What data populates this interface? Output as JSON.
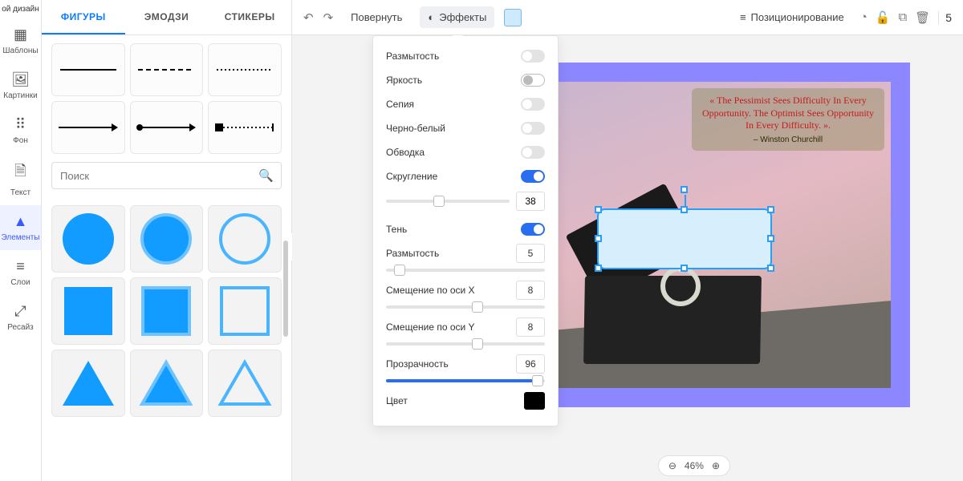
{
  "nav": {
    "top_label": "ой дизайн",
    "items": [
      {
        "icon": "▦",
        "label": "Шаблоны"
      },
      {
        "icon": "🖼",
        "label": "Картинки"
      },
      {
        "icon": "⋮⋮⋮",
        "label": "Фон"
      },
      {
        "icon": "🗎",
        "label": "Текст"
      },
      {
        "icon": "△",
        "label": "Элементы"
      },
      {
        "icon": "≋",
        "label": "Слои"
      },
      {
        "icon": "⤢",
        "label": "Ресайз"
      }
    ],
    "active_index": 4
  },
  "side": {
    "tabs": [
      "ФИГУРЫ",
      "ЭМОДЗИ",
      "СТИКЕРЫ"
    ],
    "active_tab": 0,
    "search_placeholder": "Поиск"
  },
  "toolbar": {
    "rotate": "Повернуть",
    "effects": "Эффекты",
    "positioning": "Позиционирование",
    "counter": "5"
  },
  "effects": {
    "blur": {
      "label": "Размытость",
      "on": false
    },
    "brightness": {
      "label": "Яркость",
      "on": false
    },
    "sepia": {
      "label": "Сепия",
      "on": false
    },
    "bw": {
      "label": "Черно-белый",
      "on": false
    },
    "outline": {
      "label": "Обводка",
      "on": false
    },
    "rounding": {
      "label": "Скругление",
      "on": true,
      "value": "38"
    },
    "shadow": {
      "label": "Тень",
      "on": true
    },
    "shadow_blur": {
      "label": "Размытость",
      "value": "5"
    },
    "offset_x": {
      "label": "Смещение по оси X",
      "value": "8"
    },
    "offset_y": {
      "label": "Смещение по оси Y",
      "value": "8"
    },
    "opacity": {
      "label": "Прозрачность",
      "value": "96"
    },
    "color": {
      "label": "Цвет",
      "value": "#000000"
    }
  },
  "canvas": {
    "quote": "« The Pessimist Sees Difficulty In Every Opportunity. The Optimist Sees Opportunity In Every Difficulty. ».",
    "author": "– Winston Churchill",
    "zoom": "46%"
  }
}
